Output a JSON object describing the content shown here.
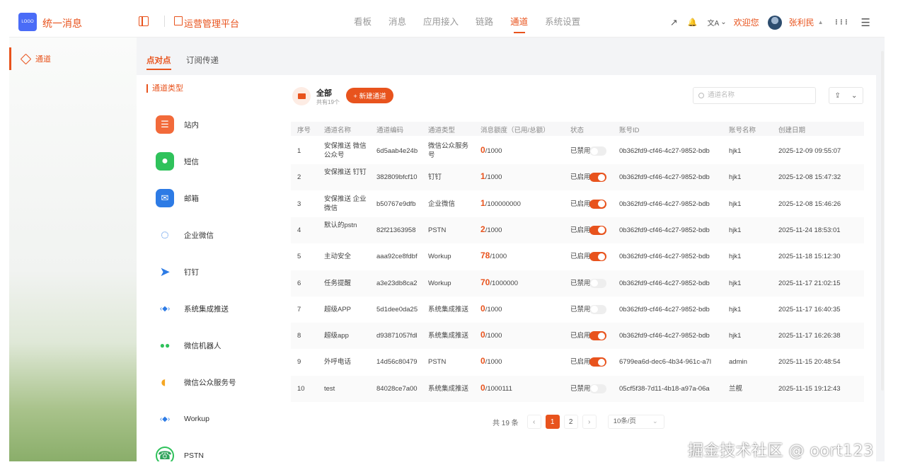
{
  "topbar": {
    "logo_text": "LOGO",
    "app_title": "统一消息",
    "platform_title": "运营管理平台",
    "nav": [
      {
        "label": "看板"
      },
      {
        "label": "消息"
      },
      {
        "label": "应用接入"
      },
      {
        "label": "链路"
      },
      {
        "label": "通道",
        "active": true
      },
      {
        "label": "系统设置"
      }
    ],
    "expand_icon": "↗",
    "bell_icon": "🔔",
    "lang_icon": "文A",
    "lang_caret": "⌄",
    "welcome": "欢迎您",
    "username": "张利民",
    "user_caret": "▲",
    "apps_icon": "⋮⋮⋮",
    "menu_icon": "☰"
  },
  "sidebar": {
    "items": [
      {
        "label": "通道"
      }
    ]
  },
  "tabs": [
    {
      "label": "点对点",
      "active": true
    },
    {
      "label": "订阅传递"
    }
  ],
  "channel_types": {
    "title": "通道类型",
    "items": [
      {
        "label": "站内",
        "icon": "inbox-icon",
        "color": "#f26a3a",
        "glyph": "☰"
      },
      {
        "label": "短信",
        "icon": "sms-icon",
        "color": "#2fc25b",
        "glyph": "●"
      },
      {
        "label": "邮箱",
        "icon": "mail-icon",
        "color": "#2d7be5",
        "glyph": "✉"
      },
      {
        "label": "企业微信",
        "icon": "wecom-icon",
        "color": "#ffffff",
        "glyph": "◌"
      },
      {
        "label": "钉钉",
        "icon": "dingtalk-icon",
        "color": "#ffffff",
        "glyph": "➤"
      },
      {
        "label": "系统集成推送",
        "icon": "system-push-icon",
        "color": "#ffffff",
        "glyph": "‹◆›"
      },
      {
        "label": "微信机器人",
        "icon": "wechat-robot-icon",
        "color": "#ffffff",
        "glyph": "●●"
      },
      {
        "label": "微信公众服务号",
        "icon": "wechat-mp-icon",
        "color": "#ffffff",
        "glyph": "◐"
      },
      {
        "label": "Workup",
        "icon": "workup-icon",
        "color": "#ffffff",
        "glyph": "‹◆›"
      },
      {
        "label": "PSTN",
        "icon": "phone-icon",
        "color": "#ffffff",
        "glyph": "☎"
      }
    ]
  },
  "list": {
    "all_label": "全部",
    "all_count": "共有19个",
    "new_button": "+ 新建通道",
    "search_placeholder": "通道名称",
    "export_icon": "⇪",
    "export_caret": "⌄",
    "headers": [
      "序号",
      "通道名称",
      "通道编码",
      "通道类型",
      "消息额度（已用/总额）",
      "状态",
      "账号ID",
      "账号名称",
      "创建日期"
    ],
    "rows": [
      {
        "no": "1",
        "name": "安保推送 微信公众号",
        "code": "6d5aab4e24b",
        "type": "微信公众服务号",
        "used": "0",
        "total": "/1000",
        "status": "已禁用",
        "on": false,
        "account_id": "0b362fd9-cf46-4c27-9852-bdb",
        "account": "hjk1",
        "date": "2025-12-09 09:55:07"
      },
      {
        "no": "2",
        "name": "安保推送 钉钉",
        "code": "382809bfcf10",
        "type": "钉钉",
        "used": "1",
        "total": "/1000",
        "status": "已启用",
        "on": true,
        "account_id": "0b362fd9-cf46-4c27-9852-bdb",
        "account": "hjk1",
        "date": "2025-12-08 15:47:32"
      },
      {
        "no": "3",
        "name": "安保推送 企业微信",
        "code": "b50767e9dfb",
        "type": "企业微信",
        "used": "1",
        "total": "/100000000",
        "status": "已启用",
        "on": true,
        "account_id": "0b362fd9-cf46-4c27-9852-bdb",
        "account": "hjk1",
        "date": "2025-12-08 15:46:26"
      },
      {
        "no": "4",
        "name": "默认的pstn",
        "code": "82f21363958",
        "type": "PSTN",
        "used": "2",
        "total": "/1000",
        "status": "已启用",
        "on": true,
        "account_id": "0b362fd9-cf46-4c27-9852-bdb",
        "account": "hjk1",
        "date": "2025-11-24 18:53:01"
      },
      {
        "no": "5",
        "name": "主动安全",
        "code": "aaa92ce8fdbf",
        "type": "Workup",
        "used": "78",
        "total": "/1000",
        "status": "已启用",
        "on": true,
        "account_id": "0b362fd9-cf46-4c27-9852-bdb",
        "account": "hjk1",
        "date": "2025-11-18 15:12:30"
      },
      {
        "no": "6",
        "name": "任务提醒",
        "code": "a3e23db8ca2",
        "type": "Workup",
        "used": "70",
        "total": "/1000000",
        "status": "已禁用",
        "on": false,
        "account_id": "0b362fd9-cf46-4c27-9852-bdb",
        "account": "hjk1",
        "date": "2025-11-17 21:02:15"
      },
      {
        "no": "7",
        "name": "超级APP",
        "code": "5d1dee0da25",
        "type": "系统集成推送",
        "used": "0",
        "total": "/1000",
        "status": "已禁用",
        "on": false,
        "account_id": "0b362fd9-cf46-4c27-9852-bdb",
        "account": "hjk1",
        "date": "2025-11-17 16:40:35"
      },
      {
        "no": "8",
        "name": "超级app",
        "code": "d93871057fdl",
        "type": "系统集成推送",
        "used": "0",
        "total": "/1000",
        "status": "已启用",
        "on": true,
        "account_id": "0b362fd9-cf46-4c27-9852-bdb",
        "account": "hjk1",
        "date": "2025-11-17 16:26:38"
      },
      {
        "no": "9",
        "name": "外呼电话",
        "code": "14d56c80479",
        "type": "PSTN",
        "used": "0",
        "total": "/1000",
        "status": "已启用",
        "on": true,
        "account_id": "6799ea6d-dec6-4b34-961c-a7l",
        "account": "admin",
        "date": "2025-11-15 20:48:54"
      },
      {
        "no": "10",
        "name": "test",
        "code": "84028ce7a00",
        "type": "系统集成推送",
        "used": "0",
        "total": "/1000111",
        "status": "已禁用",
        "on": false,
        "account_id": "05cf5f38-7d11-4b18-a97a-06a",
        "account": "兰舰",
        "date": "2025-11-15 19:12:43"
      }
    ]
  },
  "pagination": {
    "total": "共 19 条",
    "prev": "‹",
    "pages": [
      "1",
      "2"
    ],
    "next": "›",
    "page_size": "10条/页",
    "caret": "⌄"
  },
  "watermark": "掘金技术社区 @ oort123",
  "colors": {
    "accent": "#e8531d"
  }
}
